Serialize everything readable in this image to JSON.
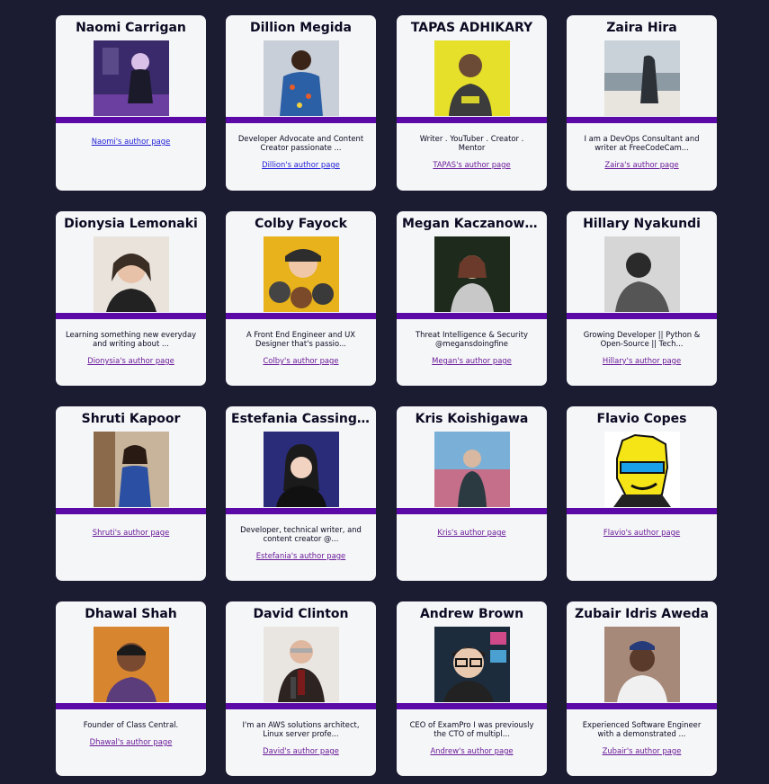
{
  "authors": [
    {
      "name": "Naomi Carrigan",
      "bio": "",
      "link": "Naomi's author page",
      "photo_bg": "#3b2a6b",
      "photo_fg": "#d8c0e8"
    },
    {
      "name": "Dillion Megida",
      "bio": "Developer Advocate and Content Creator passionate ...",
      "link": "Dillion's author page",
      "photo_bg": "#c9cfd8",
      "photo_fg": "#3a2418"
    },
    {
      "name": "TAPAS ADHIKARY",
      "bio": "Writer . YouTuber . Creator . Mentor",
      "link": "TAPAS's author page",
      "photo_bg": "#e6e02a",
      "photo_fg": "#6b4a36"
    },
    {
      "name": "Zaira Hira",
      "bio": "I am a DevOps Consultant and writer at FreeCodeCam...",
      "link": "Zaira's author page",
      "photo_bg": "#aeb6bd",
      "photo_fg": "#2c3138"
    },
    {
      "name": "Dionysia Lemonaki",
      "bio": "Learning something new everyday and writing about ...",
      "link": "Dionysia's author page",
      "photo_bg": "#e9e3dc",
      "photo_fg": "#3a2e24"
    },
    {
      "name": "Colby Fayock",
      "bio": "A Front End Engineer and UX Designer that's passio...",
      "link": "Colby's author page",
      "photo_bg": "#e7b21c",
      "photo_fg": "#2d2d2d"
    },
    {
      "name": "Megan Kaczanowski",
      "bio": "Threat Intelligence & Security @megansdoingfine",
      "link": "Megan's author page",
      "photo_bg": "#1e2a1c",
      "photo_fg": "#d9c4b8"
    },
    {
      "name": "Hillary Nyakundi",
      "bio": "Growing Developer || Python & Open-Source || Tech...",
      "link": "Hillary's author page",
      "photo_bg": "#d6d6d6",
      "photo_fg": "#2a2a2a"
    },
    {
      "name": "Shruti Kapoor",
      "bio": "",
      "link": "Shruti's author page",
      "photo_bg": "#c8b49a",
      "photo_fg": "#2b4fa3"
    },
    {
      "name": "Estefania Cassingena N...",
      "bio": "Developer, technical writer, and content creator @...",
      "link": "Estefania's author page",
      "photo_bg": "#2a2c7a",
      "photo_fg": "#1b1b1b"
    },
    {
      "name": "Kris Koishigawa",
      "bio": "",
      "link": "Kris's author page",
      "photo_bg": "#c56f8a",
      "photo_fg": "#2b3a40"
    },
    {
      "name": "Flavio Copes",
      "bio": "",
      "link": "Flavio's author page",
      "photo_bg": "#ffffff",
      "photo_fg": "#f5e416"
    },
    {
      "name": "Dhawal Shah",
      "bio": "Founder of Class Central.",
      "link": "Dhawal's author page",
      "photo_bg": "#d7862f",
      "photo_fg": "#5a3d7a"
    },
    {
      "name": "David Clinton",
      "bio": "I'm an AWS solutions architect, Linux server profe...",
      "link": "David's author page",
      "photo_bg": "#e9e6e2",
      "photo_fg": "#2d2320"
    },
    {
      "name": "Andrew Brown",
      "bio": "CEO of ExamPro I was previously the CTO of multipl...",
      "link": "Andrew's author page",
      "photo_bg": "#1c2c3c",
      "photo_fg": "#e9c8b0"
    },
    {
      "name": "Zubair Idris Aweda",
      "bio": "Experienced Software Engineer with a demonstrated ...",
      "link": "Zubair's author page",
      "photo_bg": "#a7897a",
      "photo_fg": "#263b7a"
    }
  ]
}
